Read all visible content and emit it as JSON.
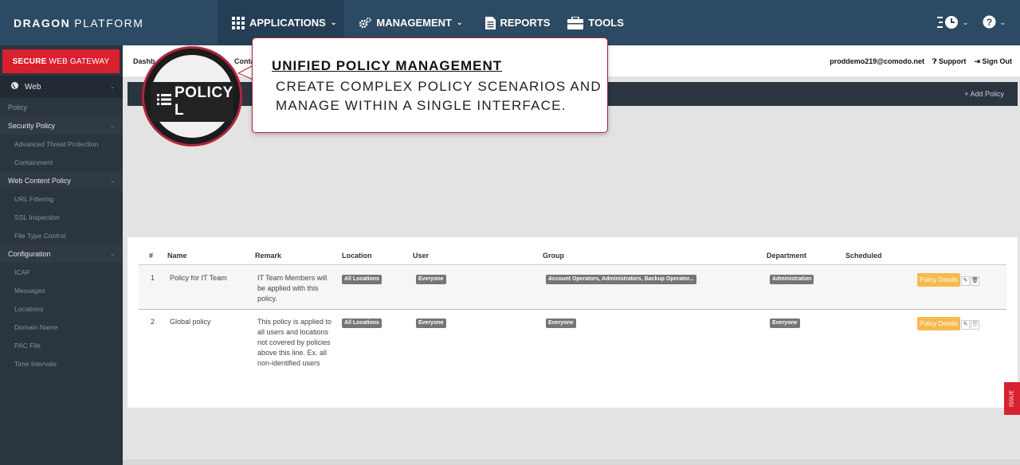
{
  "brand": {
    "bold": "DRAGON",
    "light": "PLATFORM"
  },
  "nav": {
    "items": [
      {
        "label": "APPLICATIONS",
        "caret": "⌄",
        "icon": "grid-icon"
      },
      {
        "label": "MANAGEMENT",
        "caret": "⌄",
        "icon": "gears-icon"
      },
      {
        "label": "REPORTS",
        "icon": "document-icon"
      },
      {
        "label": "TOOLS",
        "icon": "toolbox-icon"
      }
    ]
  },
  "sidebar": {
    "product": {
      "bold": "SECURE",
      "rest": "WEB GATEWAY"
    },
    "web": "Web",
    "items": [
      {
        "label": "Policy",
        "type": "top"
      },
      {
        "label": "Security Policy",
        "type": "group"
      },
      {
        "label": "Advanced Threat Protection",
        "type": "sub"
      },
      {
        "label": "Containment",
        "type": "sub"
      },
      {
        "label": "Web Content Policy",
        "type": "group"
      },
      {
        "label": "URL Filtering",
        "type": "sub"
      },
      {
        "label": "SSL Inspection",
        "type": "sub"
      },
      {
        "label": "File Type Control",
        "type": "sub"
      },
      {
        "label": "Configuration",
        "type": "group"
      },
      {
        "label": "ICAP",
        "type": "sub"
      },
      {
        "label": "Messages",
        "type": "sub"
      },
      {
        "label": "Locations",
        "type": "sub"
      },
      {
        "label": "Domain Name",
        "type": "sub"
      },
      {
        "label": "PAC File",
        "type": "sub"
      },
      {
        "label": "Time Intervals",
        "type": "sub"
      }
    ]
  },
  "header": {
    "crumb_dashboard": "Dashb",
    "crumb_containment": "Containm",
    "email": "proddemo219@comodo.net",
    "support": "Support",
    "signout": "Sign Out"
  },
  "titlebar": {
    "add_policy": "Add Policy"
  },
  "table": {
    "headers": [
      "#",
      "Name",
      "Remark",
      "Location",
      "User",
      "Group",
      "Department",
      "Scheduled"
    ],
    "rows": [
      {
        "num": "1",
        "name": "Policy for IT Team",
        "remark": "IT Team Members will be applied with this policy.",
        "location": "All Locations",
        "user": "Everyone",
        "group": "Account Operators, Administrators, Backup Operator...",
        "department": "Administration",
        "details": "Policy Details"
      },
      {
        "num": "2",
        "name": "Global policy",
        "remark": "This policy is applied to all users and locations not covered by policies above this line. Ex. all non-identified users",
        "location": "All Locations",
        "user": "Everyone",
        "group": "Everyone",
        "department": "Everyone",
        "details": "Policy Details"
      }
    ]
  },
  "callout": {
    "title": "UNIFIED POLICY MANAGEMENT",
    "body": "CREATE COMPLEX POLICY SCENARIOS AND MANAGE WITHIN A SINGLE INTERFACE."
  },
  "magnifier": {
    "text": "POLICY L"
  },
  "issue_tab": "ISSUE",
  "colors": {
    "accent_red": "#d8202e",
    "topbar": "#2c4a63",
    "sidebar": "#2b3540",
    "details_orange": "#f7b94d"
  }
}
